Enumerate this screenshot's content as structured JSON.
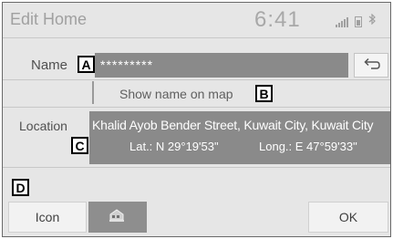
{
  "header": {
    "title": "Edit Home",
    "clock": "6:41",
    "status_icons": [
      "signal-icon",
      "battery-icon",
      "bluetooth-icon"
    ]
  },
  "name_row": {
    "label": "Name",
    "value": "*********"
  },
  "show_name_row": {
    "label": "Show name on map"
  },
  "location_row": {
    "label": "Location",
    "address": "Khalid Ayob Bender Street, Kuwait City, Kuwait City",
    "latitude": "Lat.: N 29°19'53\"",
    "longitude": "Long.: E 47°59'33\""
  },
  "footer": {
    "icon_label": "Icon",
    "ok_label": "OK"
  },
  "callouts": {
    "a": "A",
    "b": "B",
    "c": "C",
    "d": "D"
  }
}
